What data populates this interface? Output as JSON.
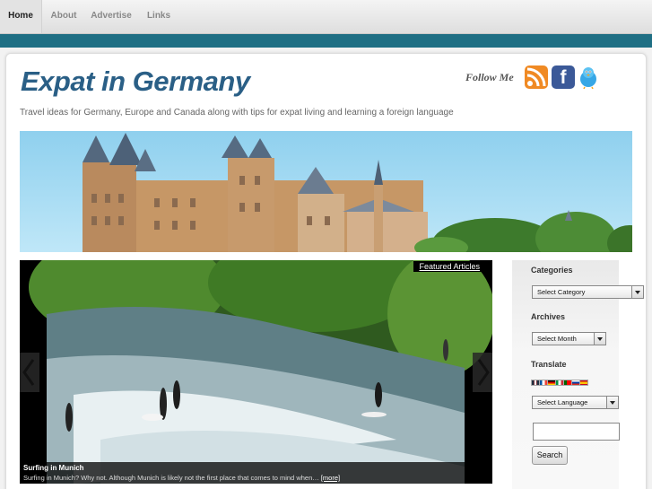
{
  "nav": {
    "items": [
      {
        "label": "Home"
      },
      {
        "label": "About"
      },
      {
        "label": "Advertise"
      },
      {
        "label": "Links"
      }
    ]
  },
  "site": {
    "title": "Expat in Germany",
    "tagline": "Travel ideas for Germany, Europe and Canada along with tips for expat living and learning a foreign language",
    "follow_label": "Follow Me"
  },
  "social": [
    "rss-icon",
    "facebook-icon",
    "twitter-icon"
  ],
  "slider": {
    "featured_label": "Featured Articles",
    "caption_title": "Surfing in Munich",
    "caption_text": "Surfing in Munich?  Why not.  Although Munich is likely not the first place that comes to mind when…",
    "more_label": "[more]"
  },
  "sidebar": {
    "categories_heading": "Categories",
    "categories_selected": "Select Category",
    "archives_heading": "Archives",
    "archives_selected": "Select Month",
    "translate_heading": "Translate",
    "language_selected": "Select Language",
    "search_button": "Search"
  },
  "colors": {
    "accent_bar": "#1f6f84",
    "title": "#2a5f86"
  }
}
